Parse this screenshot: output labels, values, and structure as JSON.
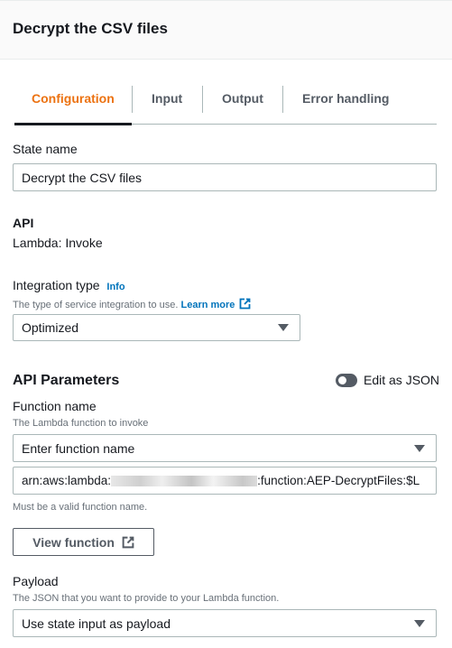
{
  "header": {
    "title": "Decrypt the CSV files"
  },
  "tabs": [
    {
      "label": "Configuration",
      "active": true
    },
    {
      "label": "Input"
    },
    {
      "label": "Output"
    },
    {
      "label": "Error handling"
    }
  ],
  "state_name": {
    "label": "State name",
    "value": "Decrypt the CSV files"
  },
  "api": {
    "label": "API",
    "value": "Lambda: Invoke"
  },
  "integration": {
    "label": "Integration type",
    "info": "Info",
    "description": "The type of service integration to use.",
    "learn_more": "Learn more",
    "value": "Optimized"
  },
  "api_params": {
    "title": "API Parameters",
    "edit_json_label": "Edit as JSON",
    "edit_json_on": false
  },
  "function_name": {
    "label": "Function name",
    "description": "The Lambda function to invoke",
    "select_value": "Enter function name",
    "arn_prefix": "arn:aws:lambda:",
    "arn_suffix": ":function:AEP-DecryptFiles:$L",
    "hint": "Must be a valid function name.",
    "view_button": "View function"
  },
  "payload": {
    "label": "Payload",
    "description": "The JSON that you want to provide to your Lambda function.",
    "value": "Use state input as payload"
  },
  "colors": {
    "accent": "#ec7211",
    "link": "#0073bb"
  }
}
